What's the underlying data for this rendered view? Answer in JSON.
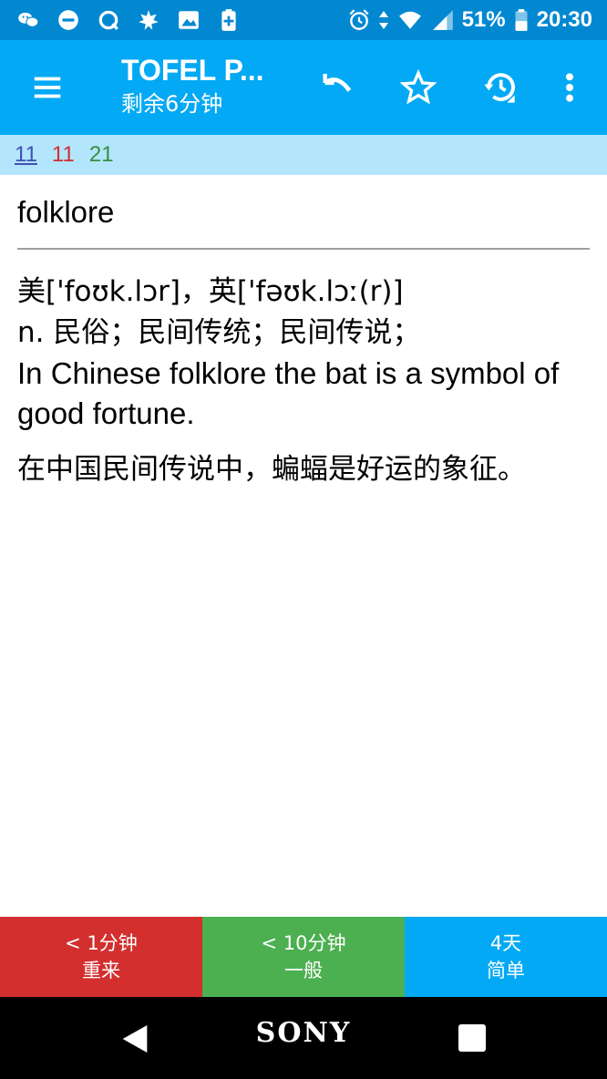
{
  "status_bar": {
    "battery": "51%",
    "time": "20:30",
    "left_icons": [
      "wechat-icon",
      "dnd-icon",
      "sync-icon",
      "leaf-icon",
      "image-icon",
      "battery-plus-icon"
    ],
    "right_icons": [
      "alarm-icon",
      "data-arrows-icon",
      "wifi-icon",
      "signal-icon",
      "battery-icon"
    ]
  },
  "toolbar": {
    "title": "TOFEL P...",
    "subtitle": "剩余6分钟",
    "actions": [
      "menu-icon",
      "undo-icon",
      "star-icon",
      "history-icon",
      "more-vert-icon"
    ]
  },
  "counts": {
    "new": "11",
    "learning": "11",
    "review": "21"
  },
  "card": {
    "question": "folklore",
    "pronunciation": "美['foʊk.lɔr]，英['fəʊk.lɔː(r)]",
    "definition": "n. 民俗；民间传统；民间传说；",
    "example_en": "In Chinese folklore the bat is a symbol of good fortune.",
    "example_zh": "在中国民间传说中，蝙蝠是好运的象征。"
  },
  "answer_buttons": {
    "again": {
      "interval": "< 1分钟",
      "label": "重来"
    },
    "good": {
      "interval": "< 10分钟",
      "label": "一般"
    },
    "easy": {
      "interval": "4天",
      "label": "简单"
    }
  },
  "colors": {
    "status_bar": "#0288D1",
    "toolbar": "#03A9F4",
    "counts_bar": "#B3E5FC",
    "again": "#D32F2F",
    "good": "#4CAF50",
    "easy": "#03A9F4"
  },
  "nav_bar": {
    "brand": "SONY"
  }
}
